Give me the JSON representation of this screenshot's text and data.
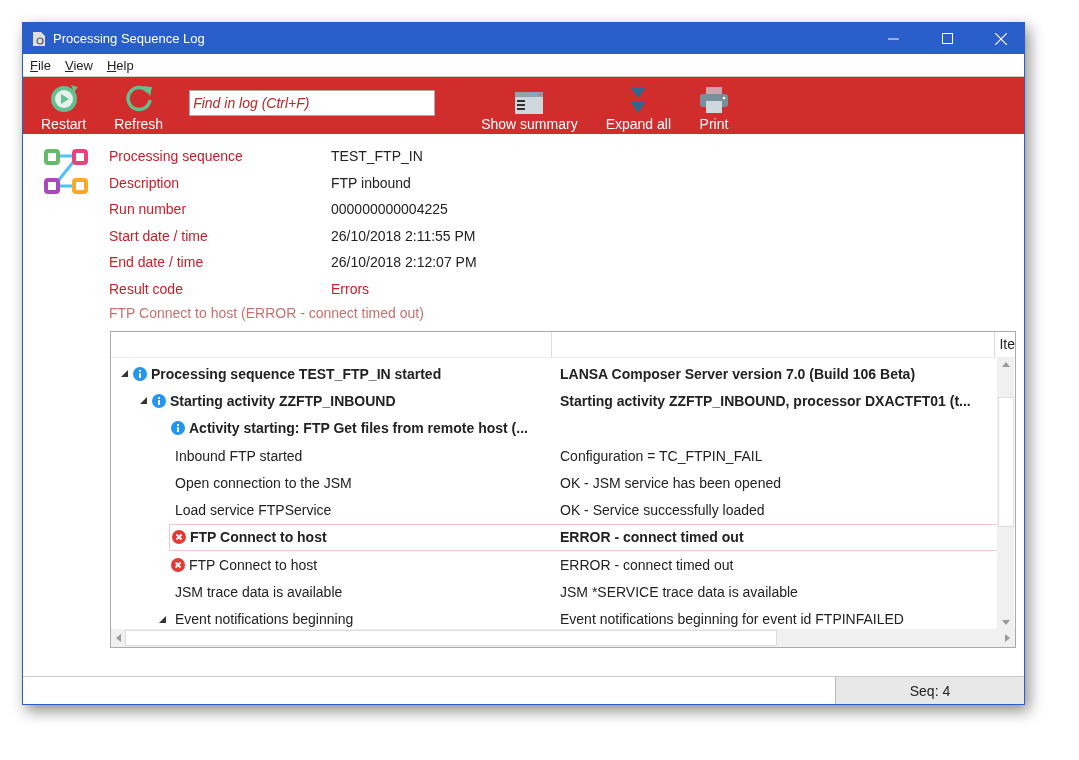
{
  "window": {
    "title": "Processing Sequence Log"
  },
  "menu": [
    {
      "label": "File"
    },
    {
      "label": "View"
    },
    {
      "label": "Help"
    }
  ],
  "toolbar": {
    "buttons": [
      {
        "kind": "restart",
        "label": "Restart"
      },
      {
        "kind": "refresh",
        "label": "Refresh"
      },
      {
        "kind": "search",
        "placeholder": "Find in log (Ctrl+F)"
      },
      {
        "kind": "summary",
        "label": "Show summary"
      },
      {
        "kind": "expand",
        "label": "Expand all"
      },
      {
        "kind": "print",
        "label": "Print"
      }
    ]
  },
  "details": [
    {
      "label": "Processing sequence",
      "value": "TEST_FTP_IN",
      "error": false
    },
    {
      "label": "Description",
      "value": "FTP inbound",
      "error": false
    },
    {
      "label": "Run number",
      "value": "000000000004225",
      "error": false
    },
    {
      "label": "Start date / time",
      "value": "26/10/2018 2:11:55 PM",
      "error": false
    },
    {
      "label": "End date / time",
      "value": "26/10/2018 2:12:07 PM",
      "error": false
    },
    {
      "label": "Result code",
      "value": "Errors",
      "error": true
    }
  ],
  "error_message": "FTP Connect to host (ERROR - connect timed out)",
  "table": {
    "header_column_3": "Ite",
    "rows": [
      {
        "text": "Processing sequence TEST_FTP_IN started",
        "detail": "LANSA Composer Server version 7.0 (Build 106 Beta)",
        "kind": "info",
        "bold": true,
        "selected": false,
        "expanded": true,
        "children": [
          {
            "text": "Starting activity ZZFTP_INBOUND",
            "detail": "Starting activity ZZFTP_INBOUND, processor DXACTFT01 (t...",
            "kind": "info",
            "bold": true,
            "selected": false,
            "expanded": true,
            "children": [
              {
                "text": "Activity starting: FTP Get files from remote host (...",
                "kind": "info",
                "bold": true,
                "selected": false
              },
              {
                "text": "Inbound FTP started",
                "detail": "Configuration = TC_FTPIN_FAIL",
                "bold": false,
                "selected": false
              },
              {
                "text": "Open connection to the JSM",
                "detail": "OK - JSM service has been opened",
                "bold": false,
                "selected": false
              },
              {
                "text": "Load service FTPService",
                "detail": "OK - Service successfully loaded",
                "bold": false,
                "selected": false
              },
              {
                "text": "FTP Connect to host",
                "detail": "ERROR - connect timed out",
                "kind": "error",
                "bold": true,
                "selected": true
              },
              {
                "text": "FTP Connect to host",
                "detail": "ERROR - connect timed out",
                "kind": "error",
                "bold": false,
                "selected": false
              },
              {
                "text": "JSM trace data is available",
                "detail": "JSM *SERVICE trace data is available",
                "bold": false,
                "selected": false
              },
              {
                "text": "Event notifications beginning",
                "detail": "Event notifications beginning for event id FTPINFAILED",
                "bold": false,
                "selected": false,
                "expanded": true
              }
            ]
          }
        ]
      }
    ]
  },
  "status_bar": {
    "seq": "Seq: 4"
  }
}
